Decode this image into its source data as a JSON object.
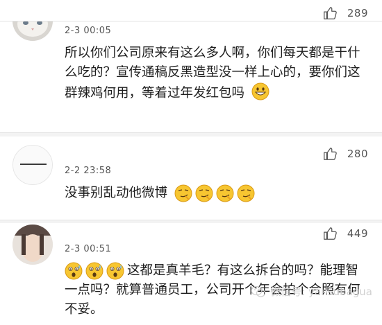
{
  "comments": [
    {
      "timestamp": "2-3 00:05",
      "like_count": "289",
      "avatar": "cat-photo",
      "text": "所以你们公司原来有这么多人啊，你们每天都是干什么吃的？宣传通稿反黑造型没一样上心的，要你们这群辣鸡何用，等着过年发红包吗",
      "emoji": "grinning-face"
    },
    {
      "timestamp": "2-2 23:58",
      "like_count": "280",
      "avatar": "blank",
      "text": "没事别乱动他微博",
      "emoji": "smirking-face x4"
    },
    {
      "timestamp": "2-3 00:51",
      "like_count": "449",
      "avatar": "person-photo",
      "emoji_prefix": "astonished-face x3",
      "text": "这都是真羊毛？有这么拆台的吗？能理智一点吗？就算普通员工，公司开个年会拍个合照有何不妥。"
    }
  ],
  "watermark": {
    "label": "微信号: yansubagua"
  },
  "colors": {
    "background": "#f3f3f3",
    "card": "#ffffff",
    "text": "#1e1e1e",
    "meta": "#555555",
    "watermark": "#d0d0d0"
  }
}
